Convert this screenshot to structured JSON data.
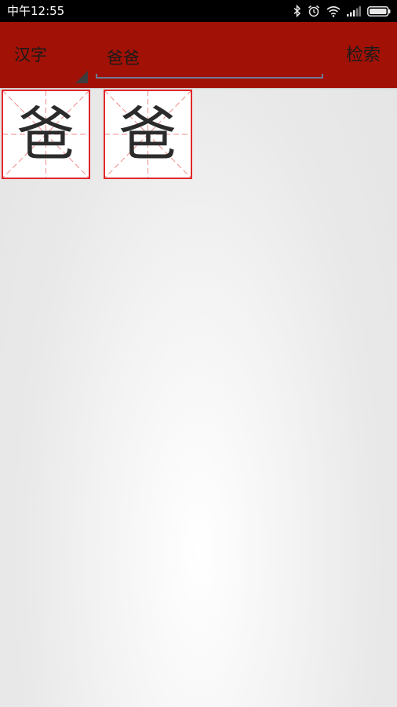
{
  "status_bar": {
    "time": "中午12:55",
    "icons": [
      "bluetooth-icon",
      "alarm-icon",
      "wifi-icon",
      "signal-icon",
      "battery-icon"
    ]
  },
  "app_bar": {
    "mode_label": "汉字",
    "search_value": "爸爸",
    "search_button_label": "检索",
    "background_color": "#a11106"
  },
  "results": {
    "characters": [
      "爸",
      "爸"
    ],
    "grid_border_color": "#e0282b",
    "grid_guide_color": "#f08a8a"
  }
}
